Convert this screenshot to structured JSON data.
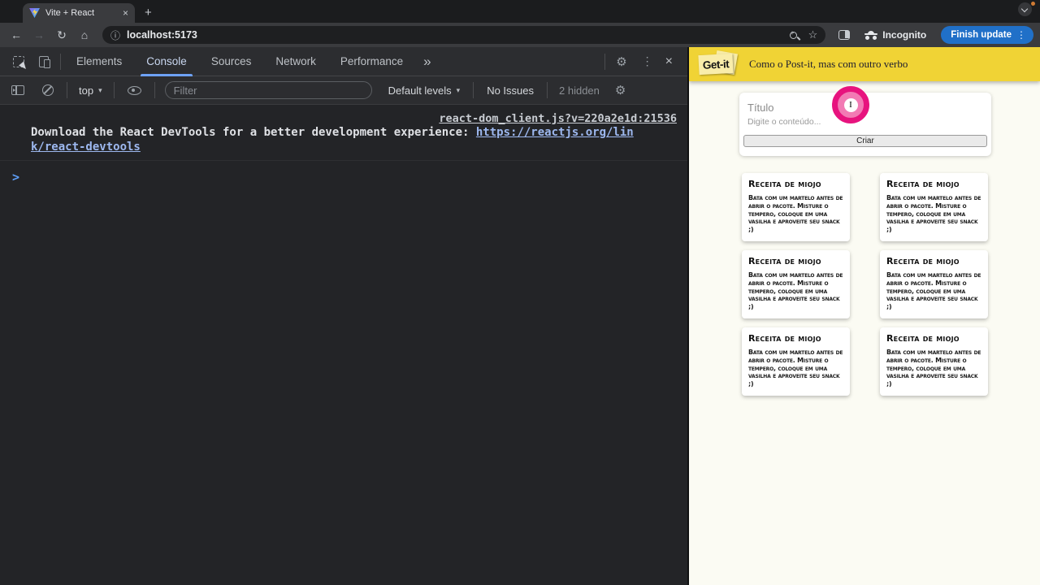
{
  "browser": {
    "tab_title": "Vite + React",
    "url": "localhost:5173",
    "incognito_label": "Incognito",
    "update_button_label": "Finish update"
  },
  "devtools": {
    "tabs": {
      "elements": "Elements",
      "console": "Console",
      "sources": "Sources",
      "network": "Network",
      "performance": "Performance"
    },
    "toolbar": {
      "context_selector": "top",
      "filter_placeholder": "Filter",
      "levels_label": "Default levels",
      "issues_label": "No Issues",
      "hidden_label": "2 hidden"
    },
    "console": {
      "source_link": "react-dom_client.js?v=220a2e1d:21536",
      "message_text": "Download the React DevTools for a better development experience: ",
      "message_link": "https://reactjs.org/link/react-devtools",
      "prompt": ">"
    }
  },
  "app": {
    "logo_text": "Get-it",
    "tagline": "Como o Post-it, mas com outro verbo",
    "form": {
      "title_placeholder": "Título",
      "content_placeholder": "Digite o conteúdo...",
      "submit_label": "Criar"
    },
    "notes": [
      {
        "title": "Receita de miojo",
        "body": "Bata com um martelo antes de abrir o pacote. Misture o tempero, coloque em uma vasilha e aproveite seu snack ;)"
      },
      {
        "title": "Receita de miojo",
        "body": "Bata com um martelo antes de abrir o pacote. Misture o tempero, coloque em uma vasilha e aproveite seu snack ;)"
      },
      {
        "title": "Receita de miojo",
        "body": "Bata com um martelo antes de abrir o pacote. Misture o tempero, coloque em uma vasilha e aproveite seu snack ;)"
      },
      {
        "title": "Receita de miojo",
        "body": "Bata com um martelo antes de abrir o pacote. Misture o tempero, coloque em uma vasilha e aproveite seu snack ;)"
      },
      {
        "title": "Receita de miojo",
        "body": "Bata com um martelo antes de abrir o pacote. Misture o tempero, coloque em uma vasilha e aproveite seu snack ;)"
      },
      {
        "title": "Receita de miojo",
        "body": "Bata com um martelo antes de abrir o pacote. Misture o tempero, coloque em uma vasilha e aproveite seu snack ;)"
      }
    ]
  },
  "icons": {
    "back": "←",
    "forward": "→",
    "reload": "↻",
    "home": "⌂",
    "info": "ⓘ",
    "star": "☆",
    "new_tab": "+",
    "close_tab": "×",
    "more_tabs": "»",
    "menu_dots": "⋮",
    "close_devtools": "×",
    "caret_down": "▾",
    "text_cursor": "I"
  },
  "colors": {
    "header_yellow": "#f0d335",
    "update_button_blue": "#2070c8",
    "devtools_accent_blue": "#6ea2f8",
    "click_highlight_pink": "#e7137e",
    "logo_note_yellow": "#f8eca6",
    "console_link_blue": "#9db8ef"
  }
}
